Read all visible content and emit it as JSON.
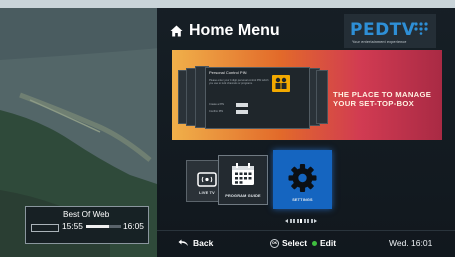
{
  "menu": {
    "title": "Home Menu"
  },
  "brand": {
    "logo": "PEDTV",
    "tagline": "Your entertainment experience"
  },
  "banner": {
    "card_title": "Personal Control PIN",
    "card_text": "Please enter your 4 digit personal control PIN which you use to lock channels or programs.",
    "field_label_1": "Create a PIN",
    "field_label_2": "Confirm PIN",
    "tagline_line1": "THE PLACE TO MANAGE",
    "tagline_line2": "YOUR SET-TOP-BOX"
  },
  "tiles": [
    {
      "label": "LIVE TV",
      "icon": "tv-broadcast-icon"
    },
    {
      "label": "PROGRAM GUIDE",
      "icon": "calendar-icon"
    },
    {
      "label": "SETTINGS",
      "icon": "gear-icon",
      "selected": true
    }
  ],
  "footer": {
    "back_label": "Back",
    "ok_label": "OK",
    "select_label": "Select",
    "edit_label": "Edit",
    "clock": "Wed. 16:01"
  },
  "now_playing": {
    "title": "Best Of Web",
    "start": "15:55",
    "end": "16:05",
    "progress": 0.65
  },
  "colors": {
    "accent": "#1565c0",
    "edit_dot": "#3fbf3f",
    "brand": "#2e8fd6"
  }
}
